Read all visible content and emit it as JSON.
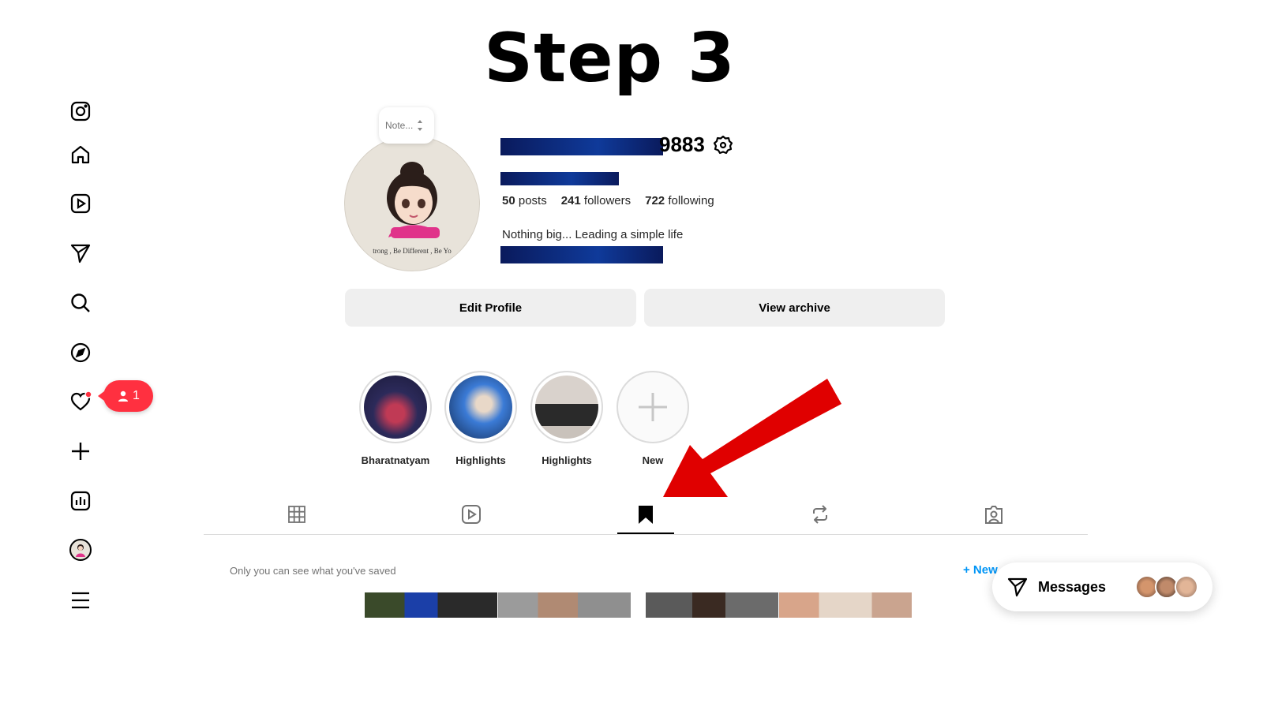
{
  "page": {
    "step_title": "Step 3"
  },
  "sidebar": {
    "items": [
      {
        "icon": "instagram-logo-icon"
      },
      {
        "icon": "home-icon"
      },
      {
        "icon": "reels-icon"
      },
      {
        "icon": "messages-icon"
      },
      {
        "icon": "search-icon"
      },
      {
        "icon": "explore-icon"
      },
      {
        "icon": "notifications-heart-icon"
      },
      {
        "icon": "create-plus-icon"
      },
      {
        "icon": "dashboard-icon"
      },
      {
        "icon": "profile-avatar-icon"
      },
      {
        "icon": "more-menu-icon"
      }
    ],
    "notification_badge": {
      "count": "1",
      "icon": "person-icon"
    }
  },
  "profile": {
    "note_placeholder": "Note...",
    "avatar_caption": "trong , Be Different , Be Yo",
    "username_visible": "9883",
    "stats": {
      "posts_count": "50",
      "posts_label": "posts",
      "followers_count": "241",
      "followers_label": "followers",
      "following_count": "722",
      "following_label": "following"
    },
    "bio": "Nothing big... Leading a simple life",
    "buttons": {
      "edit_profile": "Edit Profile",
      "view_archive": "View archive"
    }
  },
  "highlights": [
    {
      "label": "Bharatnatyam"
    },
    {
      "label": "Highlights"
    },
    {
      "label": "Highlights"
    },
    {
      "label": "New"
    }
  ],
  "tabs": [
    {
      "icon": "grid-icon",
      "active": false
    },
    {
      "icon": "reels-tab-icon",
      "active": false
    },
    {
      "icon": "saved-bookmark-icon",
      "active": true
    },
    {
      "icon": "reposts-icon",
      "active": false
    },
    {
      "icon": "tagged-icon",
      "active": false
    }
  ],
  "saved": {
    "privacy_note": "Only you can see what you've saved",
    "new_collection": "+ New"
  },
  "messages_widget": {
    "label": "Messages"
  },
  "colors": {
    "accent_red": "#ff3040",
    "arrow_red": "#e00000",
    "link_blue": "#0095f6",
    "redaction_blue": "#0f3a9a"
  }
}
